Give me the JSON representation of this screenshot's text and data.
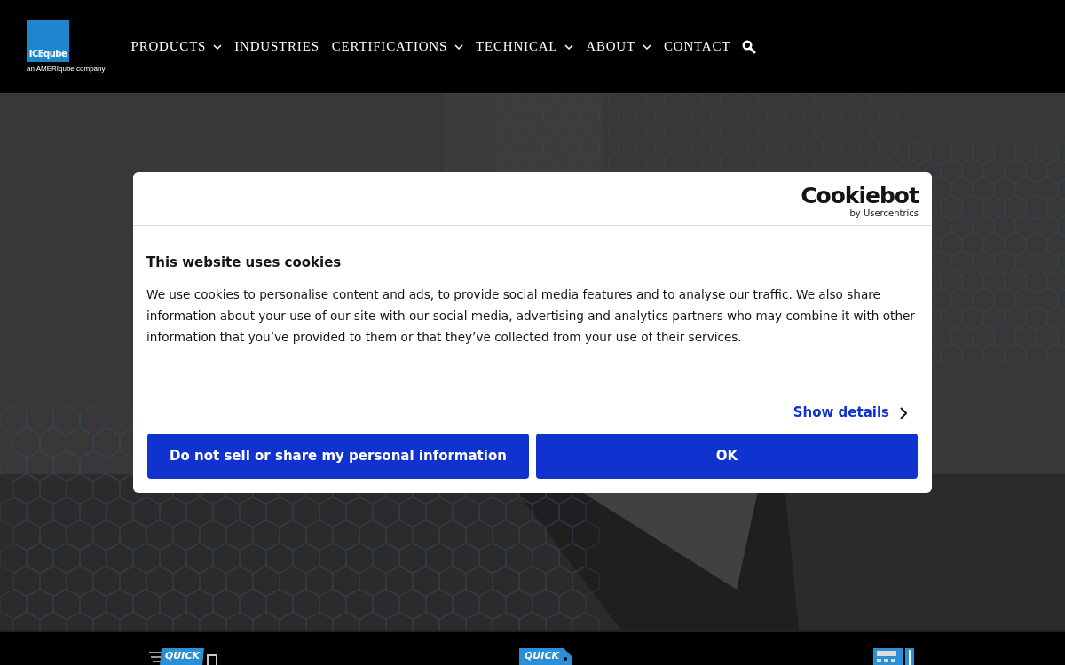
{
  "logo": {
    "name": "ICEqube",
    "tagline": "an AMERIqube company"
  },
  "nav": [
    {
      "label": "PRODUCTS",
      "dropdown": true
    },
    {
      "label": "INDUSTRIES",
      "dropdown": false
    },
    {
      "label": "CERTIFICATIONS",
      "dropdown": true
    },
    {
      "label": "TECHNICAL",
      "dropdown": true
    },
    {
      "label": "ABOUT",
      "dropdown": true
    },
    {
      "label": "CONTACT",
      "dropdown": false
    }
  ],
  "cookie_dialog": {
    "brand": "Cookiebot",
    "brand_sub": "by Usercentrics",
    "title": "This website uses cookies",
    "body": "We use cookies to personalise content and ads, to provide social media features and to analyse our traffic. We also share information about your use of our site with our social media, advertising and analytics partners who may combine it with other information that you’ve provided to them or that they’ve collected from your use of their services.",
    "details_link": "Show details",
    "buttons": [
      "Do not sell or share my personal information",
      "OK"
    ]
  },
  "quick_links": [
    {
      "kind": "ship",
      "label": "QUICK"
    },
    {
      "kind": "quote",
      "label": "QUICK"
    },
    {
      "kind": "calculator"
    }
  ]
}
